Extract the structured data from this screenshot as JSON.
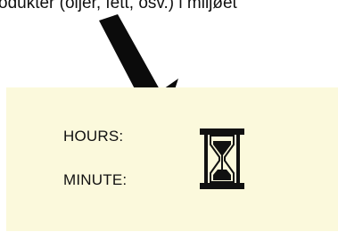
{
  "caption": {
    "text": "odukter (oljer, fett, osv.) i miljøet"
  },
  "panel": {
    "hours_label": "HOURS:",
    "minute_label": "MINUTE:",
    "background_color": "#fbf9dc"
  },
  "icons": {
    "pointer": "arrow-icon",
    "timer": "hourglass-icon"
  }
}
